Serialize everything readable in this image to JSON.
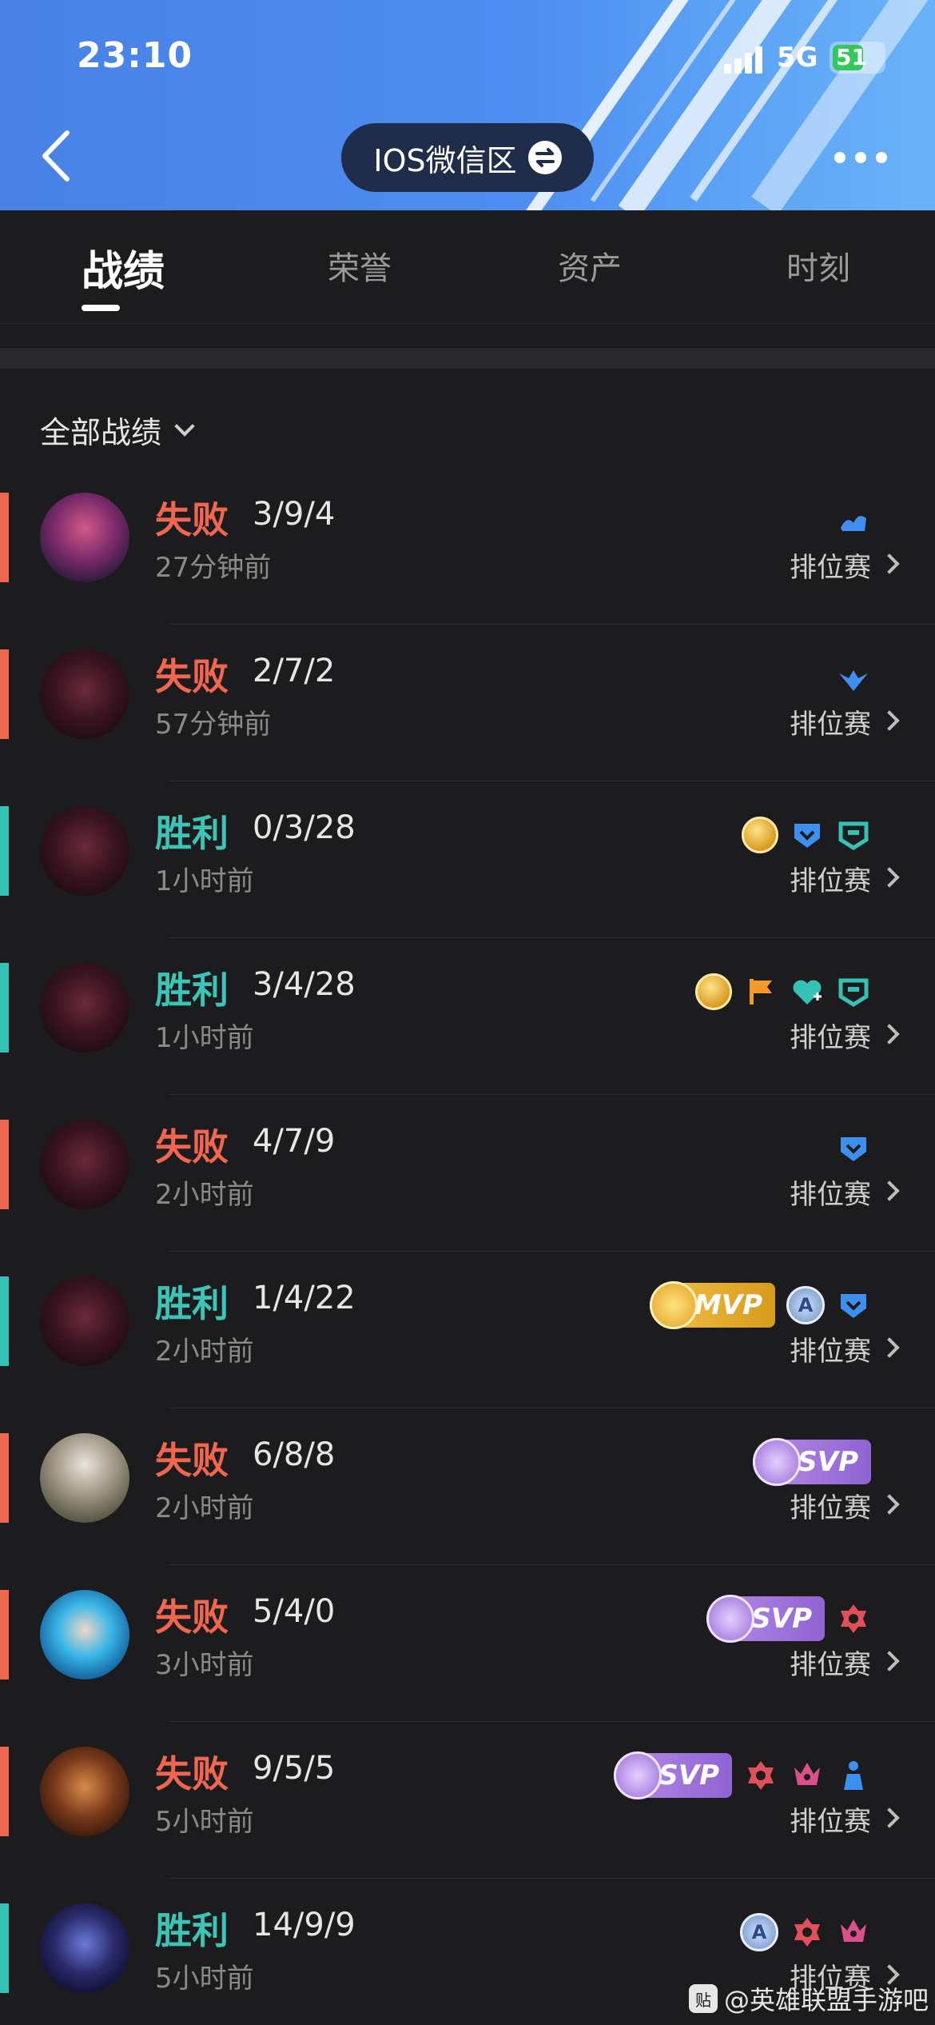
{
  "status_bar": {
    "time": "23:10",
    "network": "5G",
    "battery": "51"
  },
  "header": {
    "region": "IOS微信区",
    "back_icon": "chevron-left-icon",
    "more_icon": "more-dots-icon"
  },
  "tabs": [
    {
      "label": "战绩",
      "active": true
    },
    {
      "label": "荣誉",
      "active": false
    },
    {
      "label": "资产",
      "active": false
    },
    {
      "label": "时刻",
      "active": false
    }
  ],
  "filter": {
    "label": "全部战绩"
  },
  "colors": {
    "loss": "#f0664f",
    "win": "#3cc5b6",
    "loss_bar": "#f0664f",
    "win_bar": "#35c2b4"
  },
  "matches": [
    {
      "result": "失败",
      "outcome": "loss",
      "kda": "3/9/4",
      "time": "27分钟前",
      "mode": "排位赛",
      "avatar": "hero-avatar-red-mask",
      "badges": [
        "blue-wave-icon"
      ]
    },
    {
      "result": "失败",
      "outcome": "loss",
      "kda": "2/7/2",
      "time": "57分钟前",
      "mode": "排位赛",
      "avatar": "hero-avatar-dark-beast",
      "badges": [
        "blue-bird-icon"
      ]
    },
    {
      "result": "胜利",
      "outcome": "win",
      "kda": "0/3/28",
      "time": "1小时前",
      "mode": "排位赛",
      "avatar": "hero-avatar-dark-beast",
      "badges": [
        "gold-coin-icon",
        "blue-shield-tag-icon",
        "teal-shield-icon"
      ]
    },
    {
      "result": "胜利",
      "outcome": "win",
      "kda": "3/4/28",
      "time": "1小时前",
      "mode": "排位赛",
      "avatar": "hero-avatar-dark-beast",
      "badges": [
        "gold-coin-icon",
        "orange-flag-icon",
        "teal-heart-icon",
        "teal-shield-icon"
      ]
    },
    {
      "result": "失败",
      "outcome": "loss",
      "kda": "4/7/9",
      "time": "2小时前",
      "mode": "排位赛",
      "avatar": "hero-avatar-dark-beast",
      "badges": [
        "blue-shield-tag-icon"
      ]
    },
    {
      "result": "胜利",
      "outcome": "win",
      "kda": "1/4/22",
      "time": "2小时前",
      "mode": "排位赛",
      "avatar": "hero-avatar-dark-beast",
      "badges": [
        "mvp-badge",
        "a-rank-badge",
        "blue-shield-tag-icon"
      ],
      "badge_text": "MVP"
    },
    {
      "result": "失败",
      "outcome": "loss",
      "kda": "6/8/8",
      "time": "2小时前",
      "mode": "排位赛",
      "avatar": "hero-avatar-white-hair",
      "badges": [
        "svp-badge"
      ],
      "badge_text": "SVP"
    },
    {
      "result": "失败",
      "outcome": "loss",
      "kda": "5/4/0",
      "time": "3小时前",
      "mode": "排位赛",
      "avatar": "hero-avatar-blue-hair",
      "badges": [
        "svp-badge",
        "red-crest-icon"
      ],
      "badge_text": "SVP"
    },
    {
      "result": "失败",
      "outcome": "loss",
      "kda": "9/5/5",
      "time": "5小时前",
      "mode": "排位赛",
      "avatar": "hero-avatar-golden-warrior",
      "badges": [
        "svp-badge",
        "red-crest-icon",
        "pink-crown-icon",
        "blue-figure-icon"
      ],
      "badge_text": "SVP"
    },
    {
      "result": "胜利",
      "outcome": "win",
      "kda": "14/9/9",
      "time": "5小时前",
      "mode": "排位赛",
      "avatar": "hero-avatar-purple-hood",
      "badges": [
        "a-rank-badge",
        "red-crest-icon",
        "pink-crown-icon"
      ]
    }
  ],
  "watermark": {
    "text": "@英雄联盟手游吧",
    "logo": "贴"
  }
}
